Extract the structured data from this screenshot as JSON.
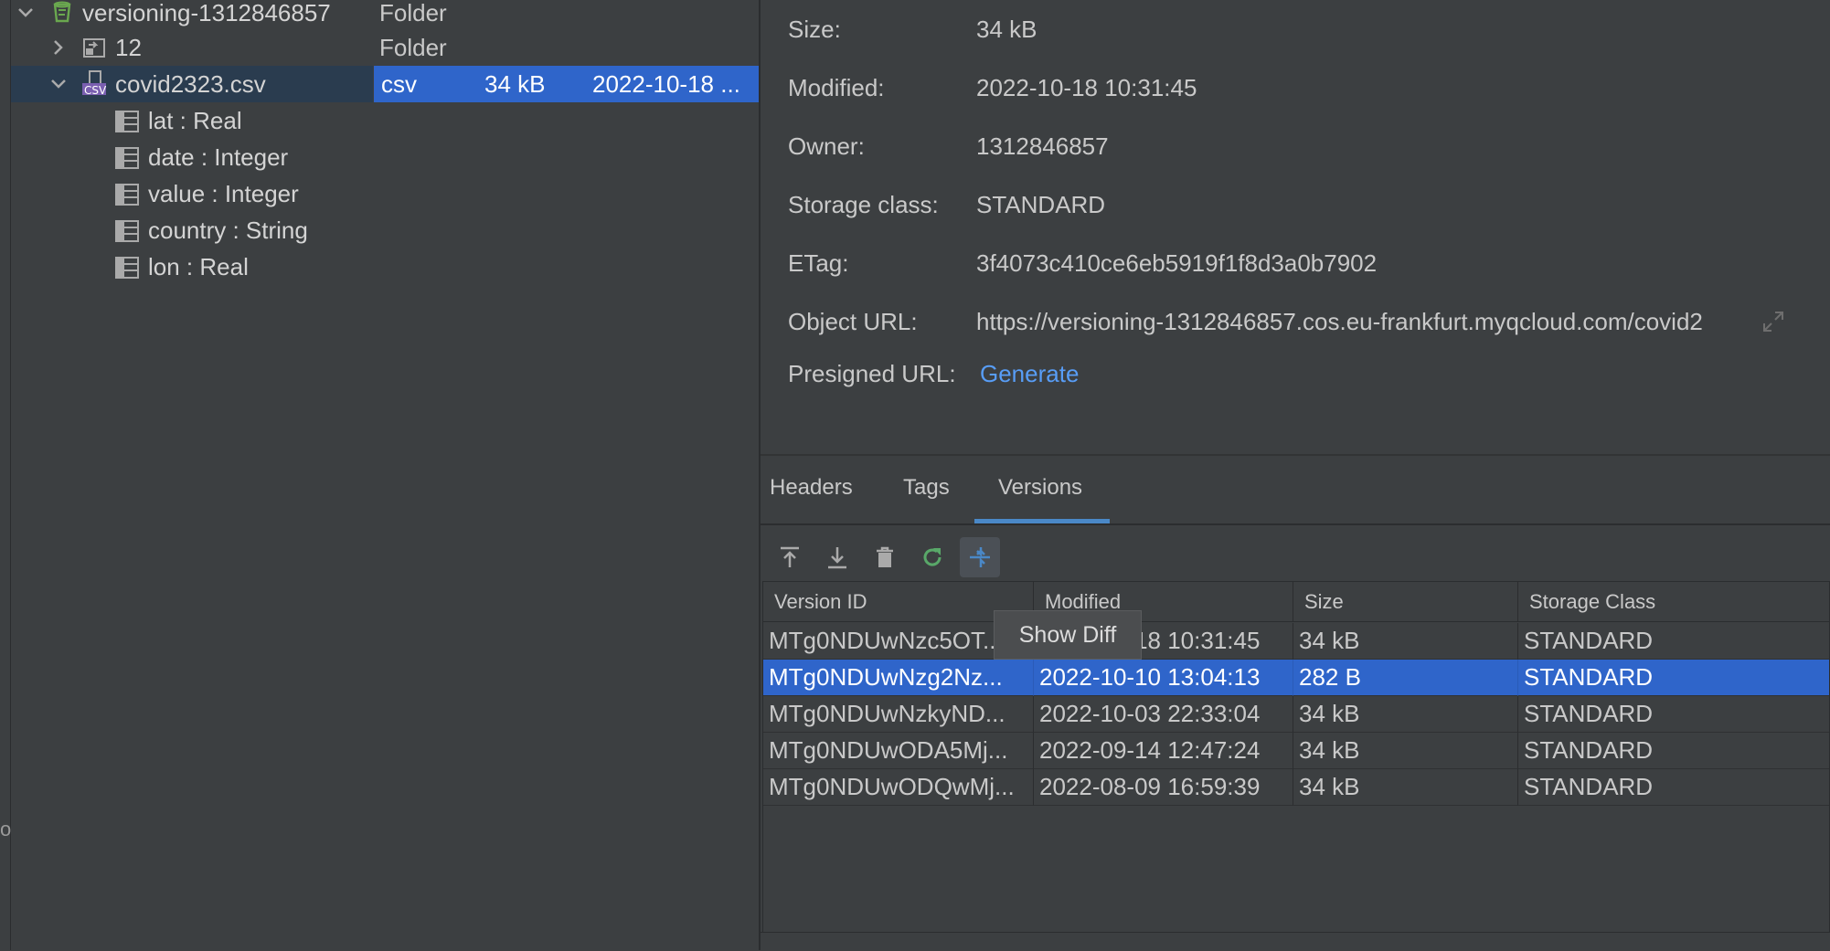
{
  "tree": {
    "rows": [
      {
        "label": "versioning-1312846857",
        "kind": "Folder"
      },
      {
        "label": "12",
        "kind": "Folder"
      },
      {
        "label": "covid2323.csv",
        "kind": "csv",
        "size": "34 kB",
        "modified": "2022-10-18 ..."
      },
      {
        "label": "lat : Real"
      },
      {
        "label": "date : Integer"
      },
      {
        "label": "value : Integer"
      },
      {
        "label": "country : String"
      },
      {
        "label": "lon : Real"
      }
    ],
    "csv_badge": "CSV"
  },
  "left_edge_glyph": "o",
  "properties": [
    {
      "key": "Size:",
      "value": "34 kB"
    },
    {
      "key": "Modified:",
      "value": "2022-10-18 10:31:45"
    },
    {
      "key": "Owner:",
      "value": "1312846857"
    },
    {
      "key": "Storage class:",
      "value": "STANDARD"
    },
    {
      "key": "ETag:",
      "value": "3f4073c410ce6eb5919f1f8d3a0b7902"
    },
    {
      "key": "Object URL:",
      "value": "https://versioning-1312846857.cos.eu-frankfurt.myqcloud.com/covid2"
    },
    {
      "key": "Presigned URL:",
      "value": "Generate"
    }
  ],
  "tabs": [
    {
      "label": "Headers"
    },
    {
      "label": "Tags"
    },
    {
      "label": "Versions",
      "active": true
    }
  ],
  "toolbar": {
    "icons": [
      "upload-icon",
      "download-icon",
      "delete-icon",
      "refresh-icon",
      "show-diff-icon"
    ]
  },
  "versions": {
    "columns": [
      "Version ID",
      "Modified",
      "Size",
      "Storage Class"
    ],
    "rows": [
      [
        "MTg0NDUwNzc5OT...",
        "2022-10-18 10:31:45",
        "34 kB",
        "STANDARD"
      ],
      [
        "MTg0NDUwNzg2Nz...",
        "2022-10-10 13:04:13",
        "282 B",
        "STANDARD"
      ],
      [
        "MTg0NDUwNzkyND...",
        "2022-10-03 22:33:04",
        "34 kB",
        "STANDARD"
      ],
      [
        "MTg0NDUwODA5Mj...",
        "2022-09-14 12:47:24",
        "34 kB",
        "STANDARD"
      ],
      [
        "MTg0NDUwODQwMj...",
        "2022-08-09 16:59:39",
        "34 kB",
        "STANDARD"
      ]
    ],
    "selected_index": 1
  },
  "tooltip": "Show Diff",
  "colors": {
    "selection": "#2f65ca",
    "link": "#589df6",
    "tab_underline": "#4a88c7",
    "bucket_green": "#6aa84f",
    "refresh_green": "#59a869",
    "diff_blue": "#4a88c7"
  }
}
